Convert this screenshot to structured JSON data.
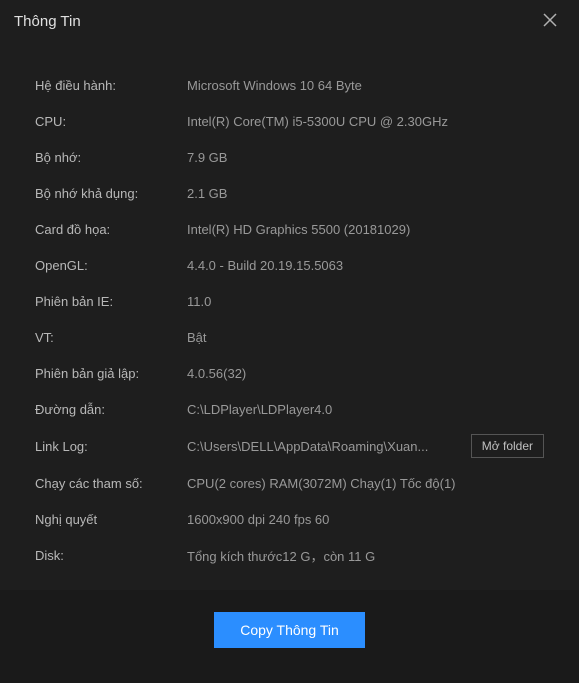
{
  "window": {
    "title": "Thông Tin"
  },
  "rows": {
    "os": {
      "label": "Hệ điều hành:",
      "value": "Microsoft Windows 10 64 Byte"
    },
    "cpu": {
      "label": "CPU:",
      "value": "Intel(R) Core(TM) i5-5300U CPU @ 2.30GHz"
    },
    "memory": {
      "label": "Bộ nhớ:",
      "value": "7.9 GB"
    },
    "avail_memory": {
      "label": "Bộ nhớ khả dụng:",
      "value": "2.1 GB"
    },
    "gpu": {
      "label": "Card đồ họa:",
      "value": "Intel(R) HD Graphics 5500 (20181029)"
    },
    "opengl": {
      "label": "OpenGL:",
      "value": "4.4.0 - Build 20.19.15.5063"
    },
    "ie": {
      "label": "Phiên bản IE:",
      "value": "11.0"
    },
    "vt": {
      "label": "VT:",
      "value": "Bật"
    },
    "emulator": {
      "label": "Phiên bản giả lập:",
      "value": "4.0.56(32)"
    },
    "path": {
      "label": "Đường dẫn:",
      "value": "C:\\LDPlayer\\LDPlayer4.0"
    },
    "linklog": {
      "label": "Link Log:",
      "value": "C:\\Users\\DELL\\AppData\\Roaming\\Xuan..."
    },
    "runparams": {
      "label": "Chạy các tham số:",
      "value": "CPU(2 cores) RAM(3072M) Chạy(1) Tốc độ(1)"
    },
    "resolution": {
      "label": "Nghị quyết",
      "value": "1600x900 dpi 240 fps 60"
    },
    "disk": {
      "label": "Disk:",
      "value": "Tổng kích thước12 G，còn 11 G"
    }
  },
  "buttons": {
    "open_folder": "Mở folder",
    "copy": "Copy Thông Tin"
  }
}
